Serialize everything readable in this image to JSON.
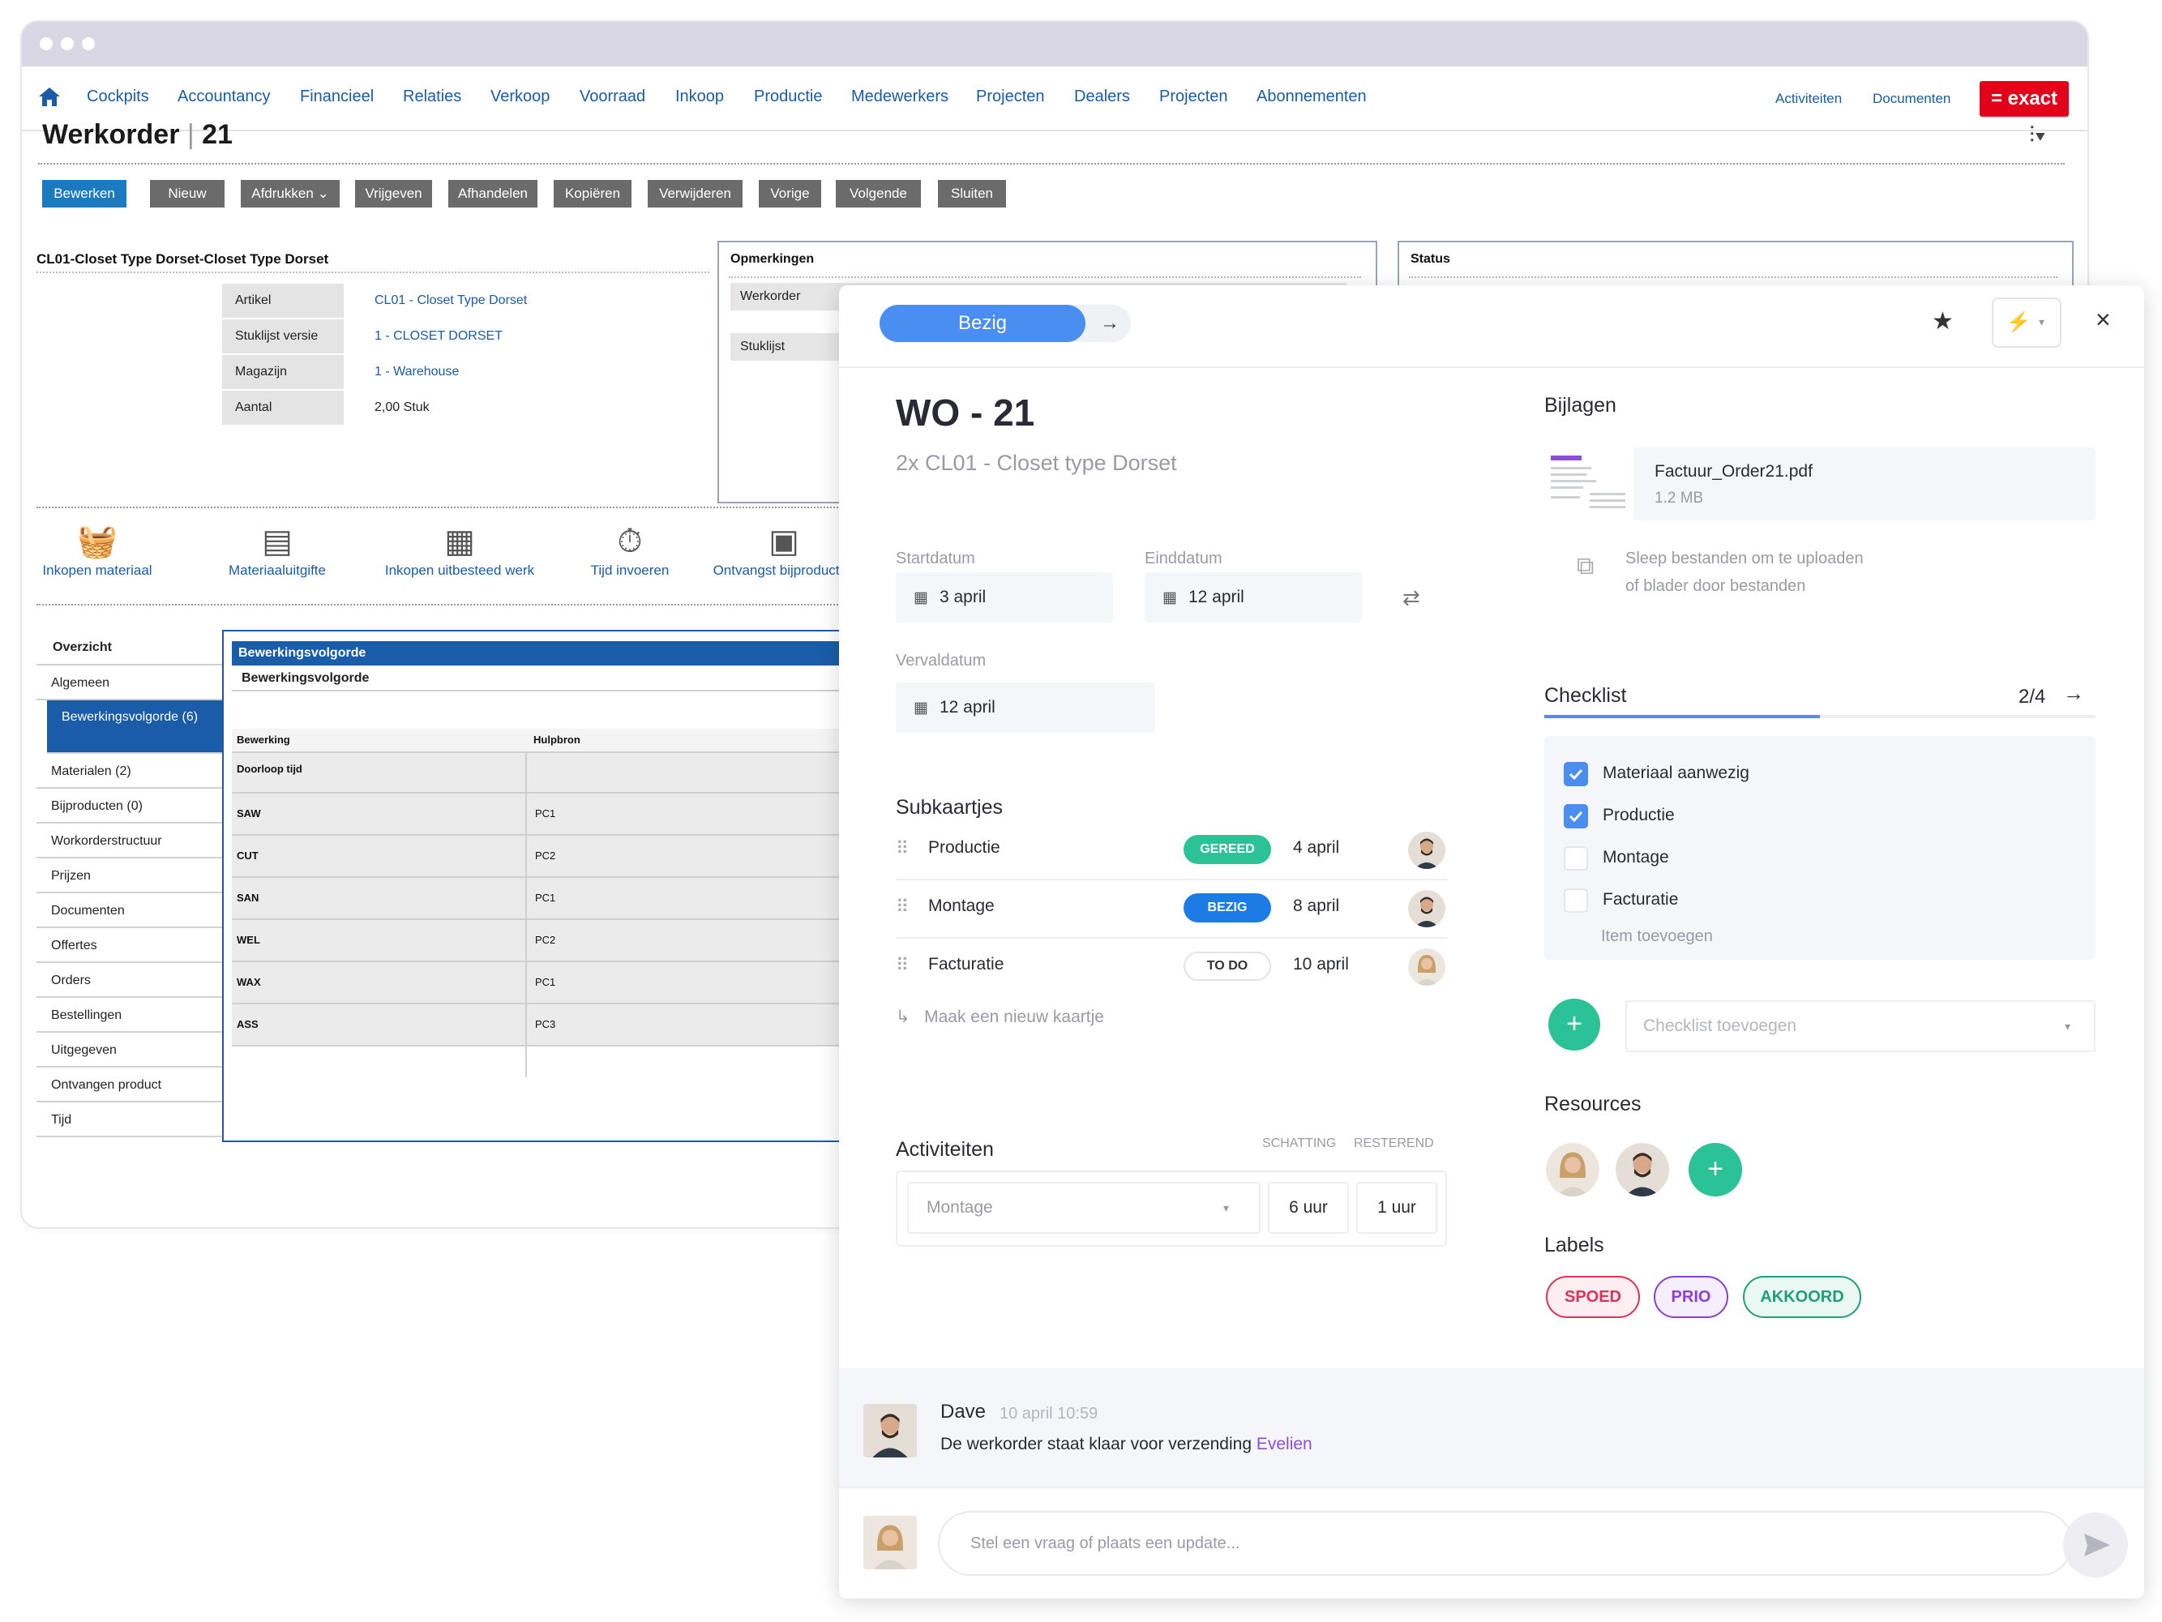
{
  "nav": {
    "items": [
      "Cockpits",
      "Accountancy",
      "Financieel",
      "Relaties",
      "Verkoop",
      "Voorraad",
      "Inkoop",
      "Productie",
      "Medewerkers",
      "Projecten",
      "Dealers",
      "Projecten",
      "Abonnementen"
    ],
    "activiteiten": "Activiteiten",
    "documenten": "Documenten",
    "logo": "= exact"
  },
  "page": {
    "title": "Werkorder",
    "number": "21"
  },
  "toolbar": [
    "Bewerken",
    "Nieuw",
    "Afdrukken",
    "Vrijgeven",
    "Afhandelen",
    "Kopiëren",
    "Verwijderen",
    "Vorige",
    "Volgende",
    "Sluiten"
  ],
  "details": {
    "title": "CL01-Closet Type Dorset-Closet Type Dorset",
    "fields": [
      {
        "label": "Artikel",
        "value": "CL01 - Closet Type Dorset"
      },
      {
        "label": "Stuklijst versie",
        "value": "1 - CLOSET DORSET"
      },
      {
        "label": "Magazijn",
        "value": "1 - Warehouse"
      },
      {
        "label": "Aantal",
        "value": "2,00 Stuk"
      }
    ]
  },
  "opmerkingen": {
    "title": "Opmerkingen",
    "werkorder": "Werkorder",
    "stuklijst": "Stuklijst"
  },
  "status_panel": {
    "title": "Status"
  },
  "actions": [
    "Inkopen materiaal",
    "Materiaaluitgifte",
    "Inkopen uitbesteed werk",
    "Tijd invoeren",
    "Ontvangst bijproducten"
  ],
  "left_nav": {
    "header": "Overzicht",
    "items": [
      "Algemeen",
      "Bewerkingsvolgorde (6)",
      "Materialen (2)",
      "Bijproducten (0)",
      "Workorderstructuur",
      "Prijzen",
      "Documenten",
      "Offertes",
      "Orders",
      "Bestellingen",
      "Uitgegeven",
      "Ontvangen product",
      "Tijd"
    ]
  },
  "operations": {
    "header": "Bewerkingsvolgorde",
    "sub": "Bewerkingsvolgorde",
    "columns": [
      "Bewerking",
      "Hulpbron"
    ],
    "first_row": "Doorloop tijd",
    "rows": [
      {
        "op": "SAW",
        "res": "PC1"
      },
      {
        "op": "CUT",
        "res": "PC2"
      },
      {
        "op": "SAN",
        "res": "PC1"
      },
      {
        "op": "WEL",
        "res": "PC2"
      },
      {
        "op": "WAX",
        "res": "PC1"
      },
      {
        "op": "ASS",
        "res": "PC3"
      }
    ]
  },
  "card": {
    "status": "Bezig",
    "title": "WO - 21",
    "subtitle": "2x CL01 - Closet type Dorset",
    "start_label": "Startdatum",
    "start_date": "3 april",
    "end_label": "Einddatum",
    "end_date": "12 april",
    "due_label": "Vervaldatum",
    "due_date": "12 april",
    "subcards_title": "Subkaartjes",
    "subcards": [
      {
        "name": "Productie",
        "status": "GEREED",
        "date": "4 april"
      },
      {
        "name": "Montage",
        "status": "BEZIG",
        "date": "8 april"
      },
      {
        "name": "Facturatie",
        "status": "TO DO",
        "date": "10 april"
      }
    ],
    "new_card": "Maak een nieuw kaartje",
    "activities_title": "Activiteiten",
    "activities_cols": [
      "SCHATTING",
      "RESTEREND"
    ],
    "activity": {
      "name": "Montage",
      "estimate": "6 uur",
      "remaining": "1 uur"
    },
    "attachments_title": "Bijlagen",
    "attachment": {
      "name": "Factuur_Order21.pdf",
      "size": "1.2 MB"
    },
    "upload_line1": "Sleep bestanden om te uploaden",
    "upload_line2": "of blader door bestanden",
    "checklist_title": "Checklist",
    "checklist_count": "2/4",
    "checklist_progress": 0.5,
    "checklist": [
      {
        "text": "Materiaal aanwezig",
        "checked": true
      },
      {
        "text": "Productie",
        "checked": true
      },
      {
        "text": "Montage",
        "checked": false
      },
      {
        "text": "Facturatie",
        "checked": false
      }
    ],
    "checklist_add_item": "Item toevoegen",
    "checklist_add": "Checklist toevoegen",
    "resources_title": "Resources",
    "labels_title": "Labels",
    "labels": [
      {
        "text": "SPOED",
        "color": "#e0315a"
      },
      {
        "text": "PRIO",
        "color": "#8b3fd6"
      },
      {
        "text": "AKKOORD",
        "color": "#1f9e78"
      }
    ],
    "comment": {
      "author": "Dave",
      "time": "10 april 10:59",
      "text": "De werkorder staat klaar voor verzending ",
      "mention": "Evelien"
    },
    "reply_placeholder": "Stel een vraag of plaats een update..."
  },
  "colors": {
    "accent": "#4b8ef1",
    "exact_red": "#e2001a",
    "exact_blue": "#1a5ca8",
    "green": "#2bc297"
  }
}
